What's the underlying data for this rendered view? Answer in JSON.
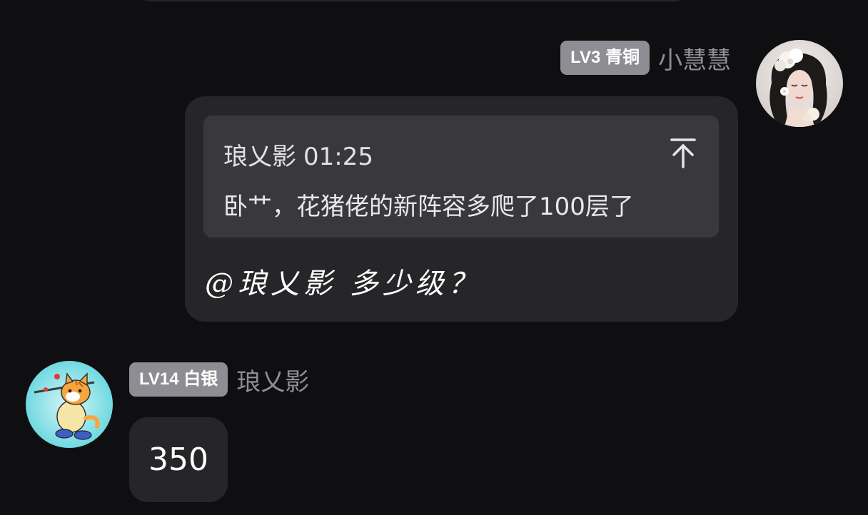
{
  "messages": [
    {
      "side": "right",
      "level_badge": "LV3 青铜",
      "username": "小慧慧",
      "avatar": "woman-portrait-avatar",
      "quote": {
        "author": "琅乂影",
        "time": "01:25",
        "text": "卧艹，花猪佬的新阵容多爬了100层了",
        "icon": "scroll-to-top-icon"
      },
      "text": "@琅乂影 多少级？"
    },
    {
      "side": "left",
      "level_badge": "LV14 白银",
      "username": "琅乂影",
      "avatar": "cartoon-cat-avatar",
      "text": "350"
    }
  ],
  "colors": {
    "background": "#0f0f12",
    "bubble": "#262629",
    "quote_box": "#39393d",
    "badge": "#8d8d93",
    "username": "#8e8e93"
  }
}
